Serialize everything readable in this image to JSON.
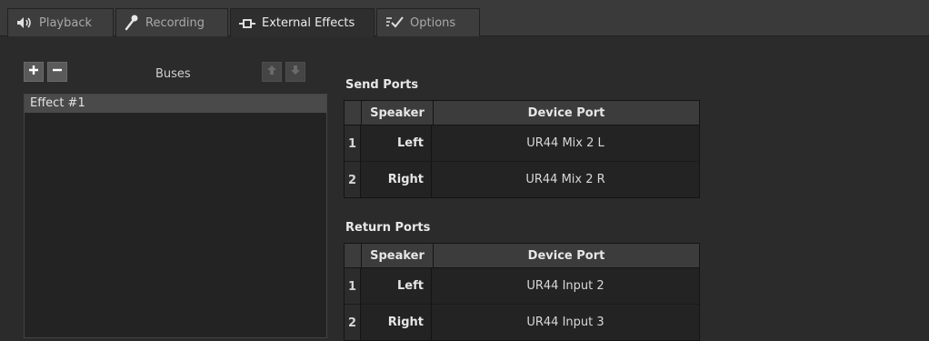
{
  "tabs": [
    {
      "label": "Playback",
      "icon": "speaker-icon"
    },
    {
      "label": "Recording",
      "icon": "microphone-icon"
    },
    {
      "label": "External Effects",
      "icon": "external-effects-icon",
      "active": true
    },
    {
      "label": "Options",
      "icon": "checkmark-icon"
    }
  ],
  "buses": {
    "title": "Buses",
    "items": [
      "Effect #1"
    ]
  },
  "send_ports": {
    "title": "Send Ports",
    "columns": [
      "Speaker",
      "Device Port"
    ],
    "rows": [
      {
        "num": "1",
        "speaker": "Left",
        "device": "UR44 Mix 2 L"
      },
      {
        "num": "2",
        "speaker": "Right",
        "device": "UR44 Mix 2 R"
      }
    ]
  },
  "return_ports": {
    "title": "Return Ports",
    "columns": [
      "Speaker",
      "Device Port"
    ],
    "rows": [
      {
        "num": "1",
        "speaker": "Left",
        "device": "UR44 Input 2"
      },
      {
        "num": "2",
        "speaker": "Right",
        "device": "UR44 Input 3"
      }
    ]
  },
  "colors": {
    "background": "#2b2b2b",
    "tabbar": "#3a3a3a",
    "selected_row": "#4a4a4a"
  }
}
